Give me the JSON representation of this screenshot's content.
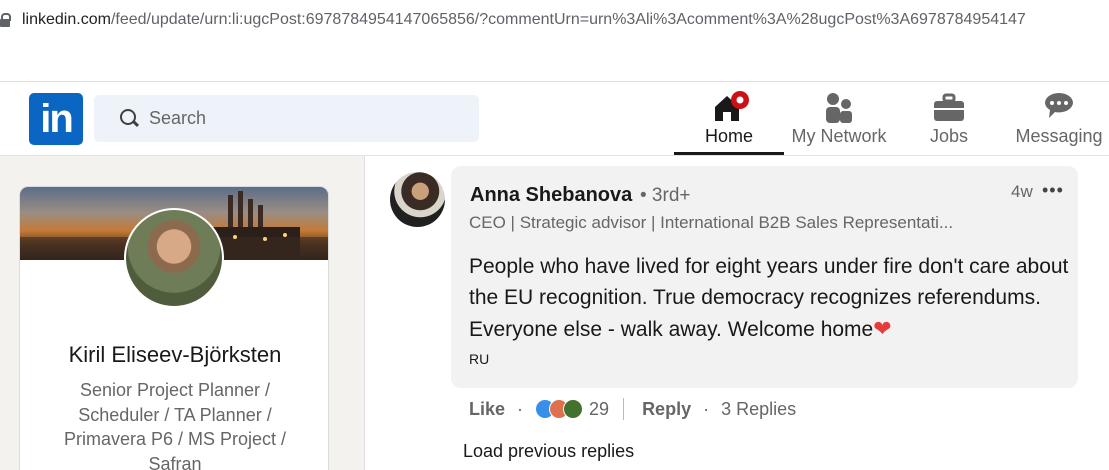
{
  "browser": {
    "url_host": "linkedin.com",
    "url_path": "/feed/update/urn:li:ugcPost:6978784954147065856/?commentUrn=urn%3Ali%3Acomment%3A%28ugcPost%3A6978784954147"
  },
  "header": {
    "logo_text": "in",
    "search_placeholder": "Search",
    "nav": [
      {
        "label": "Home",
        "icon": "home-icon",
        "active": true
      },
      {
        "label": "My Network",
        "icon": "people-icon"
      },
      {
        "label": "Jobs",
        "icon": "briefcase-icon"
      },
      {
        "label": "Messaging",
        "icon": "chat-icon"
      }
    ]
  },
  "profile": {
    "name": "Kiril Eliseev-Björksten",
    "headline": "Senior Project Planner / Scheduler / TA Planner / Primavera P6 / MS Project / Safran"
  },
  "comment": {
    "author": "Anna Shebanova",
    "degree": "• 3rd+",
    "time": "4w",
    "more": "•••",
    "headline": "CEO | Strategic advisor | International B2B Sales Representati...",
    "text": "People who have lived for eight years under fire don't care about the EU recognition. True democracy recognizes referendums. Everyone else - walk away. Welcome home",
    "heart": "❤",
    "language": "RU",
    "like_label": "Like",
    "reaction_count": "29",
    "reply_label": "Reply",
    "replies": "3 Replies",
    "dot": "·",
    "load_previous": "Load previous replies"
  },
  "colors": {
    "brand": "#0a66c2",
    "notification": "#cc1016",
    "heart": "#e63b3b"
  }
}
